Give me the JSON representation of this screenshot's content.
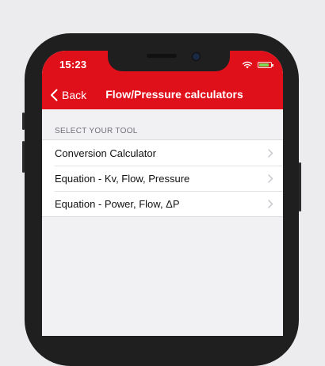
{
  "status_bar": {
    "time": "15:23",
    "icons": [
      "wifi-icon",
      "battery-icon"
    ],
    "battery_level": 0.85,
    "battery_color": "#7ed957"
  },
  "nav": {
    "back_label": "Back",
    "back_icon": "chevron-left-icon",
    "title": "Flow/Pressure calculators",
    "bar_color": "#e0101b"
  },
  "section": {
    "label": "SELECT YOUR TOOL"
  },
  "tools": [
    {
      "label": "Conversion Calculator",
      "icon": "chevron-right-icon"
    },
    {
      "label": "Equation - Kv, Flow, Pressure",
      "icon": "chevron-right-icon"
    },
    {
      "label": "Equation - Power, Flow, ΔP",
      "icon": "chevron-right-icon"
    }
  ]
}
